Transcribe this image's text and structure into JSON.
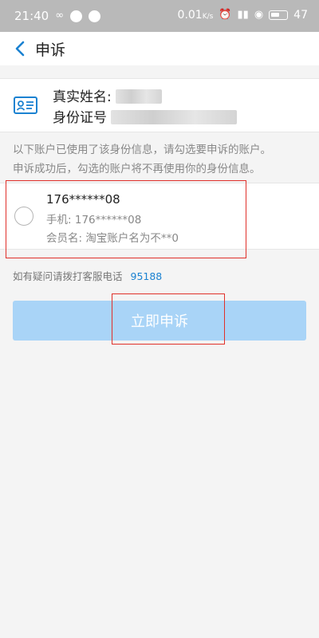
{
  "status_bar": {
    "time": "21:40",
    "speed": "0.01",
    "speed_unit": "K/s",
    "battery": "47"
  },
  "header": {
    "back_icon": "chevron-left-icon",
    "title": "申诉"
  },
  "identity": {
    "icon": "id-card-icon",
    "name_label": "真实姓名:",
    "id_label": "身份证号"
  },
  "notice": {
    "line1": "以下账户已使用了该身份信息，请勾选要申诉的账户。",
    "line2": "申诉成功后，勾选的账户将不再使用你的身份信息。"
  },
  "account": {
    "name": "176******08",
    "phone_label": "手机:",
    "phone": "176******08",
    "member_label": "会员名:",
    "member": "淘宝账户名为不**0"
  },
  "hotline": {
    "text": "如有疑问请拨打客服电话",
    "number": "95188"
  },
  "submit_label": "立即申诉",
  "colors": {
    "accent": "#1b82d1",
    "button_disabled": "#a9d4f7",
    "annotation_red": "#e0302a"
  }
}
